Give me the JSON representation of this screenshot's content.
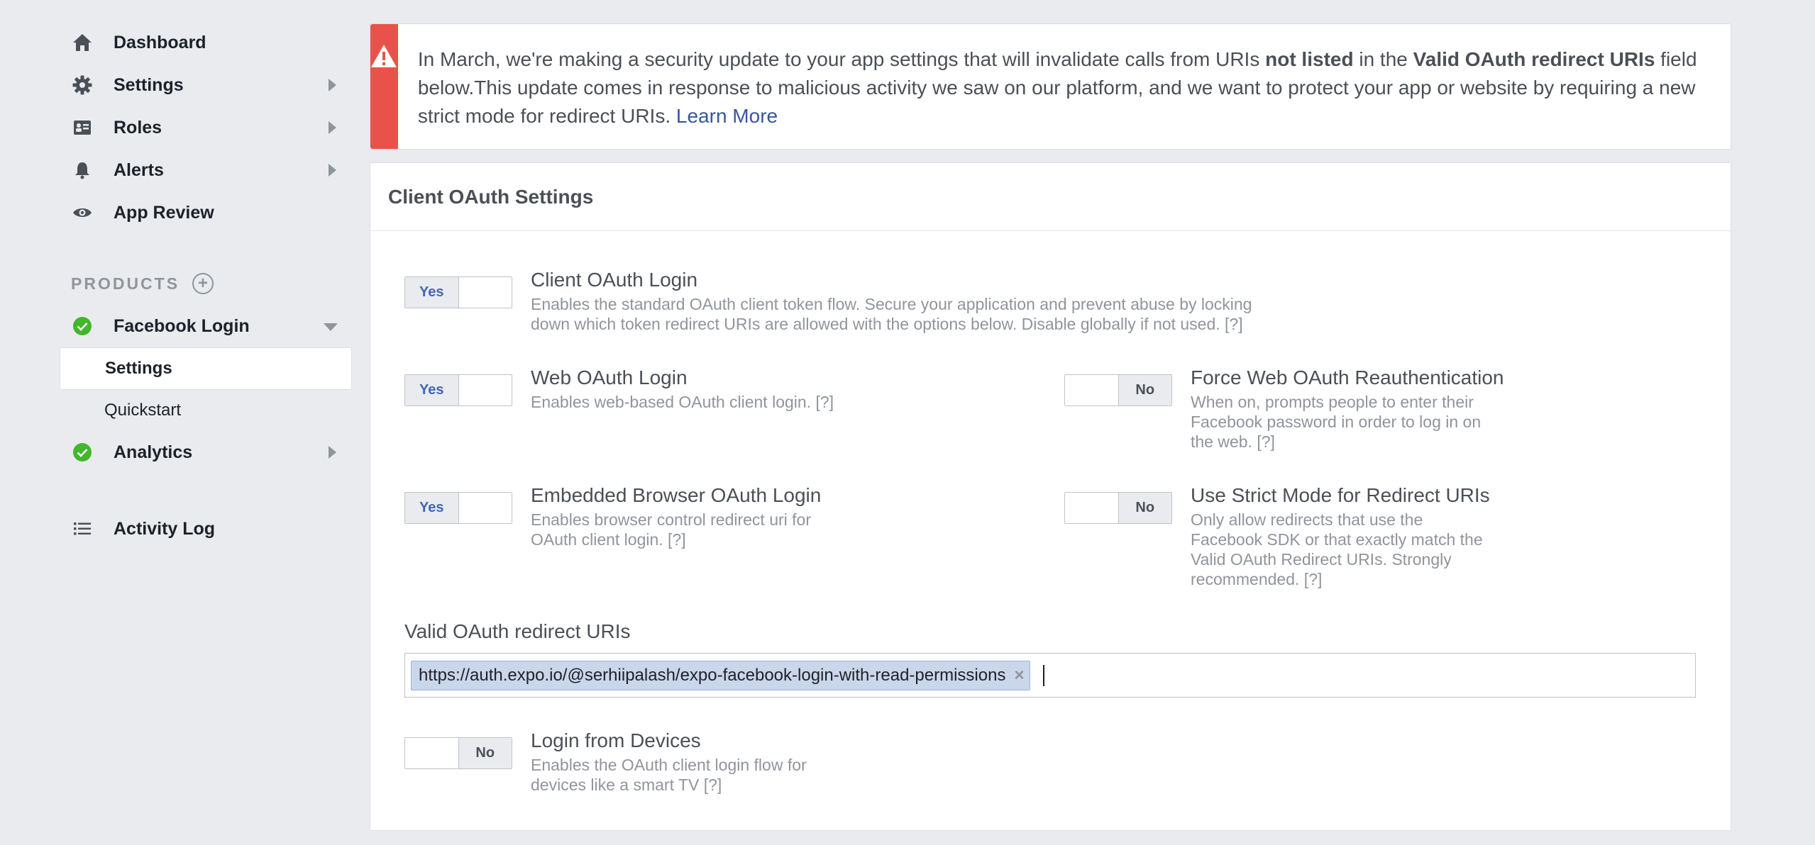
{
  "sidebar": {
    "items": [
      {
        "label": "Dashboard",
        "icon": "home-icon"
      },
      {
        "label": "Settings",
        "icon": "gear-icon"
      },
      {
        "label": "Roles",
        "icon": "id-card-icon"
      },
      {
        "label": "Alerts",
        "icon": "bell-icon"
      },
      {
        "label": "App Review",
        "icon": "eye-icon"
      }
    ],
    "products_header": "PRODUCTS",
    "facebook_login": {
      "label": "Facebook Login",
      "subitems": [
        {
          "label": "Settings",
          "active": true
        },
        {
          "label": "Quickstart",
          "active": false
        }
      ]
    },
    "analytics": {
      "label": "Analytics"
    },
    "activity_log": {
      "label": "Activity Log"
    }
  },
  "alert": {
    "text_1": "In March, we're making a security update to your app settings that will invalidate calls from URIs ",
    "bold_1": "not listed",
    "text_2": " in the ",
    "bold_2": "Valid OAuth redirect URIs",
    "text_3": " field below.This update comes in response to malicious activity we saw on our platform, and we want to protect your app or website by requiring a new strict mode for redirect URIs. ",
    "link": "Learn More",
    "color": "#e9524a"
  },
  "panel": {
    "title": "Client OAuth Settings",
    "settings": [
      {
        "title": "Client OAuth Login",
        "desc_line1": "Enables the standard OAuth client token flow. Secure your application and prevent abuse by locking",
        "desc_line2": "down which token redirect URIs are allowed with the options below. Disable globally if not used.  [?]",
        "value": "Yes"
      },
      {
        "title": "Web OAuth Login",
        "desc_line1": "Enables web-based OAuth client login.  [?]",
        "value": "Yes"
      },
      {
        "title": "Force Web OAuth Reauthentication",
        "desc_line1": "When on, prompts people to enter their",
        "desc_line2": "Facebook password in order to log in on",
        "desc_line3": "the web. [?]",
        "value": "No"
      },
      {
        "title": "Embedded Browser OAuth Login",
        "desc_line1": "Enables browser control redirect uri for",
        "desc_line2": "OAuth client login.  [?]",
        "value": "Yes"
      },
      {
        "title": "Use Strict Mode for Redirect URIs",
        "desc_line1": "Only allow redirects that use the",
        "desc_line2": "Facebook SDK or that exactly match the",
        "desc_line3": "Valid OAuth Redirect URIs. Strongly",
        "desc_line4": "recommended.  [?]",
        "value": "No"
      },
      {
        "title": "Login from Devices",
        "desc_line1": "Enables the OAuth client login flow for",
        "desc_line2": "devices like a smart TV [?]",
        "value": "No"
      }
    ],
    "uri_label": "Valid OAuth redirect URIs",
    "uri_tokens": [
      "https://auth.expo.io/@serhiipalash/expo-facebook-login-with-read-permissions"
    ],
    "token_remove": "×"
  }
}
